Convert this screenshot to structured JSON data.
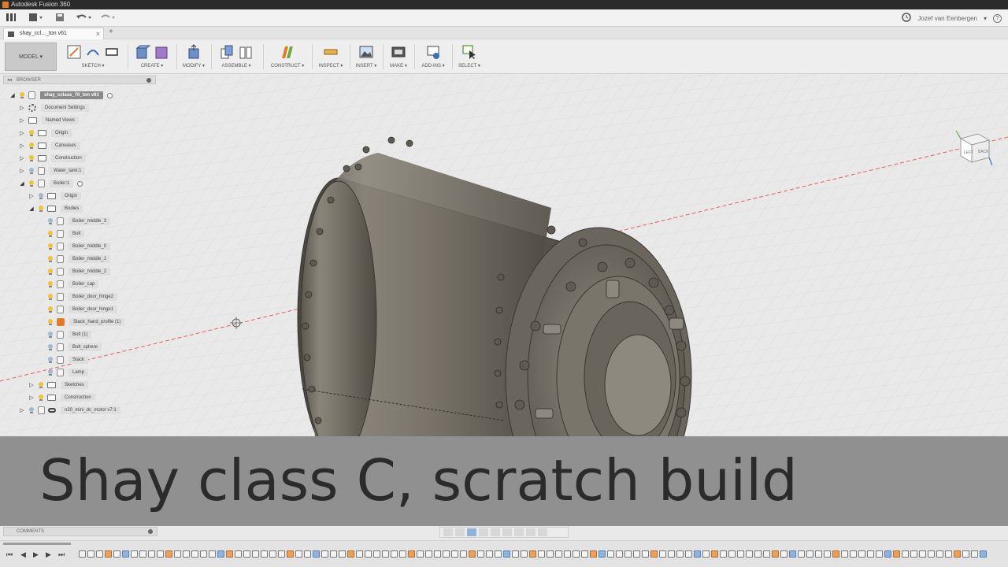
{
  "window": {
    "title": "Autodesk Fusion 360"
  },
  "quick_access": {
    "user_name": "Jozef van Eenbergen",
    "user_caret": "▾",
    "help_label": "?"
  },
  "document_tab": {
    "label": "shay_ccl..._ton v61",
    "close": "×",
    "add": "+"
  },
  "toolbar": {
    "workspace": "MODEL ▾",
    "groups": [
      "SKETCH ▾",
      "CREATE ▾",
      "MODIFY ▾",
      "ASSEMBLE ▾",
      "CONSTRUCT ▾",
      "INSPECT ▾",
      "INSERT ▾",
      "MAKE ▾",
      "ADD-INS ▾",
      "SELECT ▾"
    ]
  },
  "browser": {
    "header": "BROWSER",
    "items": [
      {
        "label": "shay_cclass_70_ton v61"
      },
      {
        "label": "Document Settings"
      },
      {
        "label": "Named Views"
      },
      {
        "label": "Origin"
      },
      {
        "label": "Canvases"
      },
      {
        "label": "Construction"
      },
      {
        "label": "Water_tank:1"
      },
      {
        "label": "Boiler:1"
      },
      {
        "label": "Origin"
      },
      {
        "label": "Bodies"
      },
      {
        "label": "Boiler_middle_3"
      },
      {
        "label": "Bolt"
      },
      {
        "label": "Boiler_middle_0"
      },
      {
        "label": "Boiler_middle_1"
      },
      {
        "label": "Boiler_middle_2"
      },
      {
        "label": "Boiler_cap"
      },
      {
        "label": "Boiler_door_hinge2"
      },
      {
        "label": "Boiler_door_hinge1"
      },
      {
        "label": "Stack_hand_profile (1)"
      },
      {
        "label": "Bolt (1)"
      },
      {
        "label": "Bolt_sphere"
      },
      {
        "label": "Stack"
      },
      {
        "label": "Lamp"
      },
      {
        "label": "Sketches"
      },
      {
        "label": "Construction"
      },
      {
        "label": "n20_mini_dc_motor v7:1"
      }
    ]
  },
  "viewcube": {
    "left": "LEFT",
    "back": "BACK"
  },
  "overlay": {
    "title": "Shay class C, scratch build"
  },
  "comments": {
    "label": "COMMENTS"
  },
  "timeline": {
    "controls": [
      "⏮",
      "◀",
      "▶",
      "▶",
      "⏭"
    ]
  },
  "colors": {
    "boiler": "#6f6a60",
    "title_band": "#6e6e6e",
    "axis_red": "#e06060"
  }
}
